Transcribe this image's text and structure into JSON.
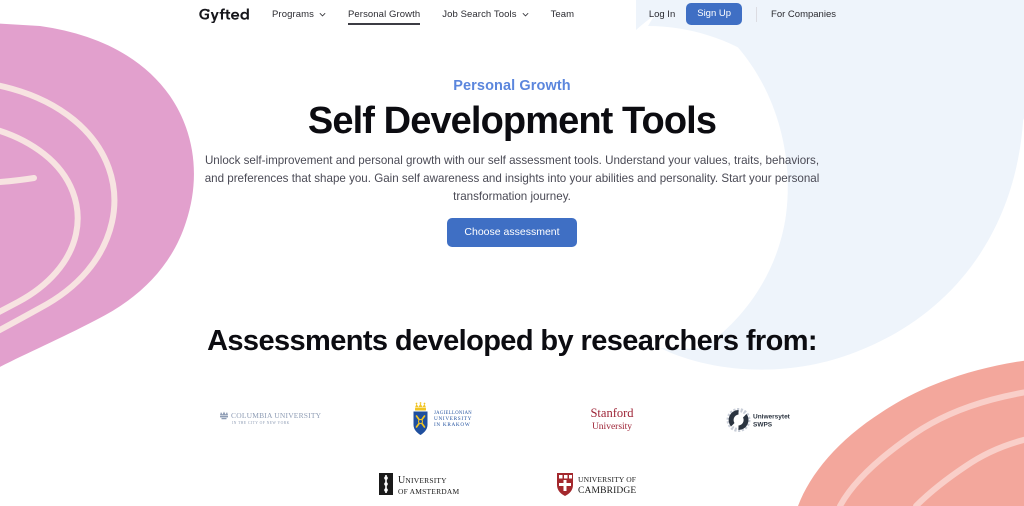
{
  "brand": {
    "name": "Gyfted",
    "logo_icon": "gyfted-wordmark"
  },
  "nav": {
    "items": [
      {
        "label": "Programs",
        "has_dropdown": true,
        "active": false,
        "icon": "chevron-down-icon"
      },
      {
        "label": "Personal Growth",
        "has_dropdown": false,
        "active": true
      },
      {
        "label": "Job Search Tools",
        "has_dropdown": true,
        "active": false,
        "icon": "chevron-down-icon"
      },
      {
        "label": "Team",
        "has_dropdown": false,
        "active": false
      }
    ],
    "login_label": "Log In",
    "signup_label": "Sign Up",
    "companies_label": "For Companies"
  },
  "hero": {
    "eyebrow": "Personal Growth",
    "title": "Self Development Tools",
    "description": "Unlock self-improvement and personal growth with our self assessment tools. Understand your values, traits, behaviors, and preferences that shape you. Gain self awareness and insights into your abilities and personality. Start your personal transformation journey.",
    "cta_label": "Choose assessment"
  },
  "researchers": {
    "heading": "Assessments developed by researchers from:",
    "row1": [
      {
        "icon": "columbia-university-logo",
        "name": "Columbia University",
        "sub": "IN THE CITY OF NEW YORK"
      },
      {
        "icon": "jagiellonian-university-logo",
        "name": "Jagiellonian University",
        "sub": "IN KRAKOW"
      },
      {
        "icon": "stanford-university-logo",
        "name": "Stanford",
        "sub": "University"
      },
      {
        "icon": "uniwersytet-swps-logo",
        "name": "Uniwersytet",
        "sub": "SWPS"
      }
    ],
    "row2": [
      {
        "icon": "university-of-amsterdam-logo",
        "name": "University",
        "sub": "of Amsterdam"
      },
      {
        "icon": "university-of-cambridge-logo",
        "name": "University of",
        "sub": "Cambridge"
      }
    ]
  },
  "colors": {
    "accent_blue": "#3f6fc4",
    "eyebrow_blue": "#5b86dd",
    "pink_blob": "#e2a0cd",
    "pink_blob_line": "#f7e3e1",
    "salmon_blob": "#f3a79c",
    "salmon_blob_line": "#f9cfc9",
    "light_blue_blob": "#eef4fb",
    "text_dark": "#0c0c11",
    "text_body": "#4a4a55"
  },
  "decor": {
    "pink_blob": "pink-blob-decoration",
    "blue_arc": "light-blue-arc-decoration",
    "salmon_blob": "salmon-blob-decoration"
  }
}
